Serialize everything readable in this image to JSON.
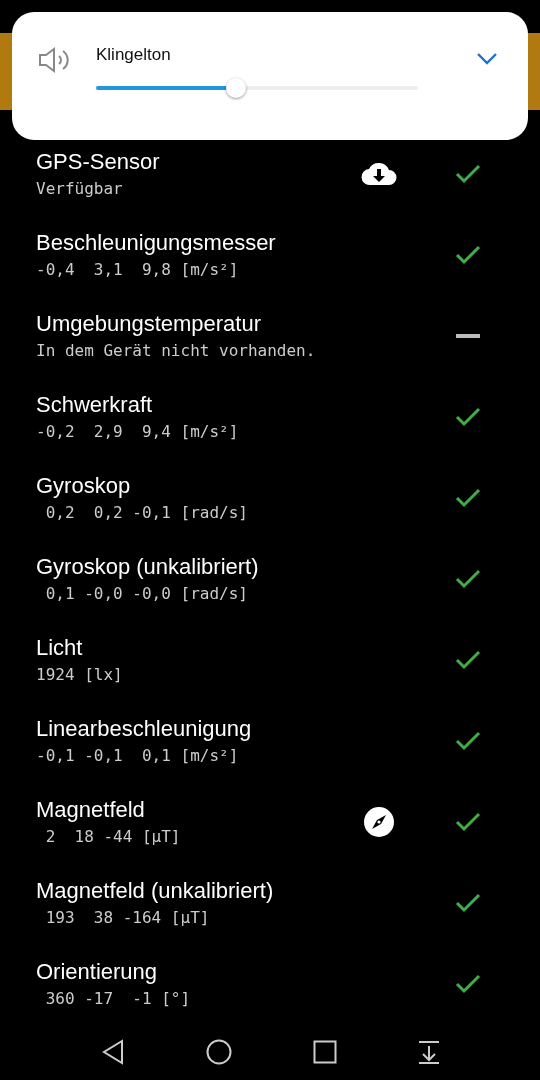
{
  "volume_panel": {
    "label": "Klingelton",
    "level": 0.41
  },
  "sensors": [
    {
      "kind": "location",
      "name": "GPS-Sensor",
      "value": "Verfügbar",
      "available": true
    },
    {
      "kind": "plain",
      "name": "Beschleunigungsmesser",
      "value": "-0,4  3,1  9,8 [m/s²]",
      "available": true
    },
    {
      "kind": "plain",
      "name": "Umgebungstemperatur",
      "value": "In dem Gerät nicht vorhanden.",
      "available": false
    },
    {
      "kind": "plain",
      "name": "Schwerkraft",
      "value": "-0,2  2,9  9,4 [m/s²]",
      "available": true
    },
    {
      "kind": "plain",
      "name": "Gyroskop",
      "value": " 0,2  0,2 -0,1 [rad/s]",
      "available": true
    },
    {
      "kind": "plain",
      "name": "Gyroskop (unkalibriert)",
      "value": " 0,1 -0,0 -0,0 [rad/s]",
      "available": true
    },
    {
      "kind": "plain",
      "name": "Licht",
      "value": "1924 [lx]",
      "available": true
    },
    {
      "kind": "plain",
      "name": "Linearbeschleunigung",
      "value": "-0,1 -0,1  0,1 [m/s²]",
      "available": true
    },
    {
      "kind": "magnetic",
      "name": "Magnetfeld",
      "value": " 2  18 -44 [μT]",
      "available": true
    },
    {
      "kind": "plain",
      "name": "Magnetfeld (unkalibriert)",
      "value": " 193  38 -164 [μT]",
      "available": true
    },
    {
      "kind": "plain",
      "name": "Orientierung",
      "value": " 360 -17  -1 [°]",
      "available": true
    }
  ]
}
